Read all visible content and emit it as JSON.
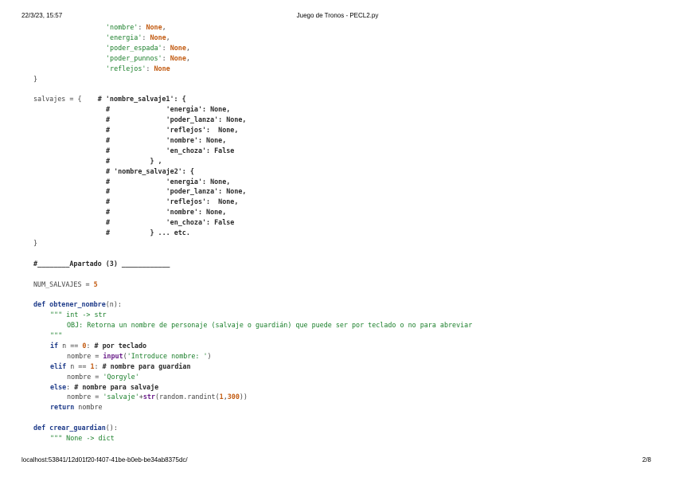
{
  "header": {
    "date": "22/3/23, 15:57",
    "title": "Juego de Tronos - PECL2.py"
  },
  "footer": {
    "url": "localhost:53841/12d01f20-f407-41be-b0eb-be34ab8375dc/",
    "page": "2/8"
  },
  "code_lines": [
    {
      "indent": 13,
      "tokens": [
        {
          "t": "'nombre'",
          "c": "s"
        },
        {
          "t": ": ",
          "c": "o"
        },
        {
          "t": "None",
          "c": "n"
        },
        {
          "t": ",",
          "c": "o"
        }
      ]
    },
    {
      "indent": 13,
      "tokens": [
        {
          "t": "'energia'",
          "c": "s"
        },
        {
          "t": ": ",
          "c": "o"
        },
        {
          "t": "None",
          "c": "n"
        },
        {
          "t": ",",
          "c": "o"
        }
      ]
    },
    {
      "indent": 13,
      "tokens": [
        {
          "t": "'poder_espada'",
          "c": "s"
        },
        {
          "t": ": ",
          "c": "o"
        },
        {
          "t": "None",
          "c": "n"
        },
        {
          "t": ",",
          "c": "o"
        }
      ]
    },
    {
      "indent": 13,
      "tokens": [
        {
          "t": "'poder_punnos'",
          "c": "s"
        },
        {
          "t": ": ",
          "c": "o"
        },
        {
          "t": "None",
          "c": "n"
        },
        {
          "t": ",",
          "c": "o"
        }
      ]
    },
    {
      "indent": 13,
      "tokens": [
        {
          "t": "'reflejos'",
          "c": "s"
        },
        {
          "t": ": ",
          "c": "o"
        },
        {
          "t": "None",
          "c": "n"
        }
      ]
    },
    {
      "indent": 0,
      "tokens": [
        {
          "t": "}",
          "c": "o"
        }
      ]
    },
    {
      "indent": 0,
      "tokens": []
    },
    {
      "indent": 0,
      "tokens": [
        {
          "t": "salvajes = {    ",
          "c": "o"
        },
        {
          "t": "# 'nombre_salvaje1': {",
          "c": "c"
        }
      ]
    },
    {
      "indent": 13,
      "tokens": [
        {
          "t": "#              'energia': None,",
          "c": "c"
        }
      ]
    },
    {
      "indent": 13,
      "tokens": [
        {
          "t": "#              'poder_lanza': None,",
          "c": "c"
        }
      ]
    },
    {
      "indent": 13,
      "tokens": [
        {
          "t": "#              'reflejos':  None,",
          "c": "c"
        }
      ]
    },
    {
      "indent": 13,
      "tokens": [
        {
          "t": "#              'nombre': None,",
          "c": "c"
        }
      ]
    },
    {
      "indent": 13,
      "tokens": [
        {
          "t": "#              'en_choza': False",
          "c": "c"
        }
      ]
    },
    {
      "indent": 13,
      "tokens": [
        {
          "t": "#          } ,",
          "c": "c"
        }
      ]
    },
    {
      "indent": 13,
      "tokens": [
        {
          "t": "# 'nombre_salvaje2': {",
          "c": "c"
        }
      ]
    },
    {
      "indent": 13,
      "tokens": [
        {
          "t": "#              'energia': None,",
          "c": "c"
        }
      ]
    },
    {
      "indent": 13,
      "tokens": [
        {
          "t": "#              'poder_lanza': None,",
          "c": "c"
        }
      ]
    },
    {
      "indent": 13,
      "tokens": [
        {
          "t": "#              'reflejos':  None,",
          "c": "c"
        }
      ]
    },
    {
      "indent": 13,
      "tokens": [
        {
          "t": "#              'nombre': None,",
          "c": "c"
        }
      ]
    },
    {
      "indent": 13,
      "tokens": [
        {
          "t": "#              'en_choza': False",
          "c": "c"
        }
      ]
    },
    {
      "indent": 13,
      "tokens": [
        {
          "t": "#          } ... etc.",
          "c": "c"
        }
      ]
    },
    {
      "indent": 0,
      "tokens": [
        {
          "t": "}",
          "c": "o"
        }
      ]
    },
    {
      "indent": 0,
      "tokens": []
    },
    {
      "indent": 0,
      "tokens": [
        {
          "t": "#________Apartado (3) ____________",
          "c": "c"
        }
      ]
    },
    {
      "indent": 0,
      "tokens": []
    },
    {
      "indent": 0,
      "tokens": [
        {
          "t": "NUM_SALVAJES = ",
          "c": "o"
        },
        {
          "t": "5",
          "c": "n"
        }
      ]
    },
    {
      "indent": 0,
      "tokens": []
    },
    {
      "indent": 0,
      "tokens": [
        {
          "t": "def ",
          "c": "k"
        },
        {
          "t": "obtener_nombre",
          "c": "f"
        },
        {
          "t": "(n):",
          "c": "o"
        }
      ]
    },
    {
      "indent": 3,
      "tokens": [
        {
          "t": "\"\"\" int -> str",
          "c": "s"
        }
      ]
    },
    {
      "indent": 6,
      "tokens": [
        {
          "t": "OBJ: Retorna un nombre de personaje (salvaje o guardián) que puede ser por teclado o no para abreviar",
          "c": "s"
        }
      ]
    },
    {
      "indent": 3,
      "tokens": [
        {
          "t": "\"\"\"",
          "c": "s"
        }
      ]
    },
    {
      "indent": 3,
      "tokens": [
        {
          "t": "if ",
          "c": "k"
        },
        {
          "t": "n == ",
          "c": "o"
        },
        {
          "t": "0",
          "c": "n"
        },
        {
          "t": ": ",
          "c": "o"
        },
        {
          "t": "# por teclado",
          "c": "c"
        }
      ]
    },
    {
      "indent": 6,
      "tokens": [
        {
          "t": "nombre = ",
          "c": "o"
        },
        {
          "t": "input",
          "c": "b"
        },
        {
          "t": "(",
          "c": "o"
        },
        {
          "t": "'Introduce nombre: '",
          "c": "s"
        },
        {
          "t": ")",
          "c": "o"
        }
      ]
    },
    {
      "indent": 3,
      "tokens": [
        {
          "t": "elif ",
          "c": "k"
        },
        {
          "t": "n == ",
          "c": "o"
        },
        {
          "t": "1",
          "c": "n"
        },
        {
          "t": ": ",
          "c": "o"
        },
        {
          "t": "# nombre para guardian",
          "c": "c"
        }
      ]
    },
    {
      "indent": 6,
      "tokens": [
        {
          "t": "nombre = ",
          "c": "o"
        },
        {
          "t": "'Qorgyle'",
          "c": "s"
        }
      ]
    },
    {
      "indent": 3,
      "tokens": [
        {
          "t": "else",
          "c": "k"
        },
        {
          "t": ": ",
          "c": "o"
        },
        {
          "t": "# nombre para salvaje",
          "c": "c"
        }
      ]
    },
    {
      "indent": 6,
      "tokens": [
        {
          "t": "nombre = ",
          "c": "o"
        },
        {
          "t": "'salvaje'",
          "c": "s"
        },
        {
          "t": "+",
          "c": "o"
        },
        {
          "t": "str",
          "c": "b"
        },
        {
          "t": "(random.randint(",
          "c": "o"
        },
        {
          "t": "1",
          "c": "n"
        },
        {
          "t": ",",
          "c": "o"
        },
        {
          "t": "300",
          "c": "n"
        },
        {
          "t": "))",
          "c": "o"
        }
      ]
    },
    {
      "indent": 3,
      "tokens": [
        {
          "t": "return ",
          "c": "k"
        },
        {
          "t": "nombre",
          "c": "o"
        }
      ]
    },
    {
      "indent": 0,
      "tokens": []
    },
    {
      "indent": 0,
      "tokens": [
        {
          "t": "def ",
          "c": "k"
        },
        {
          "t": "crear_guardian",
          "c": "f"
        },
        {
          "t": "():",
          "c": "o"
        }
      ]
    },
    {
      "indent": 3,
      "tokens": [
        {
          "t": "\"\"\" None -> dict",
          "c": "s"
        }
      ]
    }
  ]
}
